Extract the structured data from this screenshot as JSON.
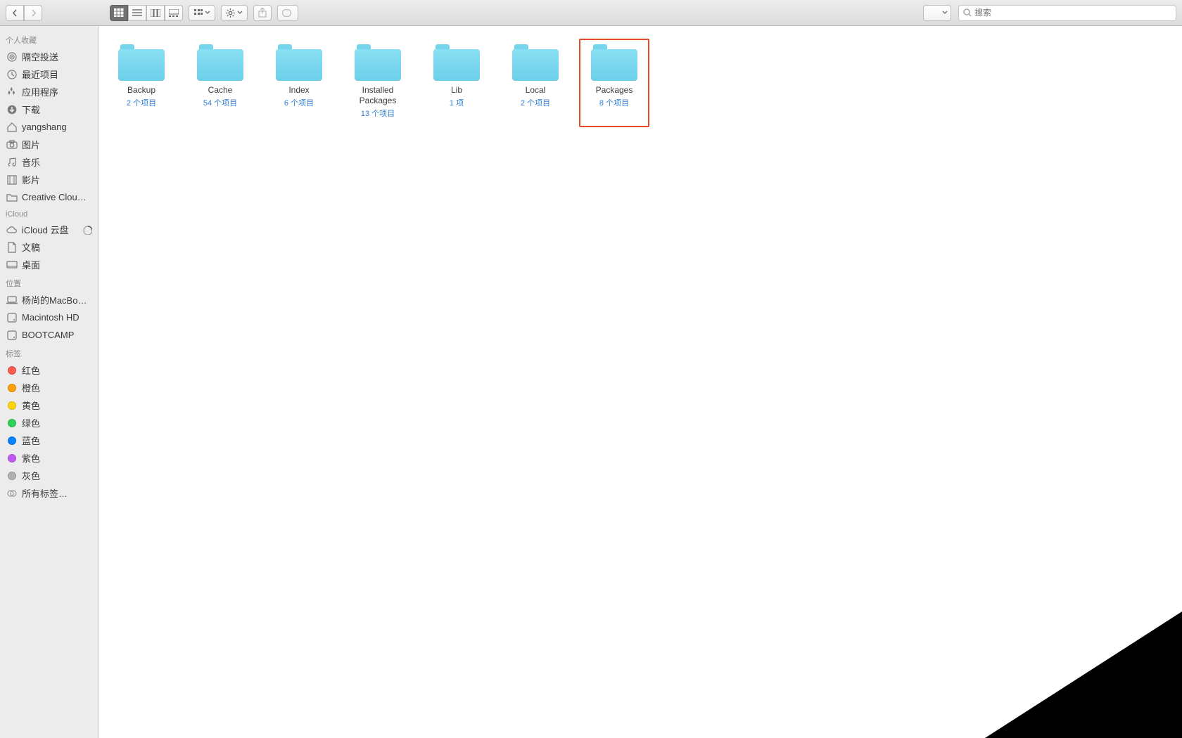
{
  "search": {
    "placeholder": "搜索"
  },
  "sidebar": {
    "sections": [
      {
        "title": "个人收藏",
        "items": [
          {
            "icon": "airdrop",
            "label": "隔空投送"
          },
          {
            "icon": "clock",
            "label": "最近项目"
          },
          {
            "icon": "apps",
            "label": "应用程序"
          },
          {
            "icon": "download",
            "label": "下载"
          },
          {
            "icon": "home",
            "label": "yangshang"
          },
          {
            "icon": "camera",
            "label": "图片"
          },
          {
            "icon": "music",
            "label": "音乐"
          },
          {
            "icon": "film",
            "label": "影片"
          },
          {
            "icon": "folder",
            "label": "Creative Clou…"
          }
        ]
      },
      {
        "title": "iCloud",
        "items": [
          {
            "icon": "cloud",
            "label": "iCloud 云盘",
            "trailing": "progress"
          },
          {
            "icon": "doc",
            "label": "文稿"
          },
          {
            "icon": "desktop",
            "label": "桌面"
          }
        ]
      },
      {
        "title": "位置",
        "items": [
          {
            "icon": "laptop",
            "label": "杨尚的MacBo…"
          },
          {
            "icon": "disk",
            "label": "Macintosh HD"
          },
          {
            "icon": "disk",
            "label": "BOOTCAMP"
          }
        ]
      },
      {
        "title": "标签",
        "items": [
          {
            "icon": "tag",
            "color": "#ff5b4f",
            "label": "红色"
          },
          {
            "icon": "tag",
            "color": "#ff9f0a",
            "label": "橙色"
          },
          {
            "icon": "tag",
            "color": "#ffd60a",
            "label": "黄色"
          },
          {
            "icon": "tag",
            "color": "#30d158",
            "label": "绿色"
          },
          {
            "icon": "tag",
            "color": "#0a84ff",
            "label": "蓝色"
          },
          {
            "icon": "tag",
            "color": "#bf5af2",
            "label": "紫色"
          },
          {
            "icon": "tag",
            "color": "#b0b0b0",
            "label": "灰色"
          },
          {
            "icon": "alltags",
            "label": "所有标签…"
          }
        ]
      }
    ]
  },
  "folders": [
    {
      "name": "Backup",
      "count": "2 个项目"
    },
    {
      "name": "Cache",
      "count": "54 个项目"
    },
    {
      "name": "Index",
      "count": "6 个项目"
    },
    {
      "name": "Installed Packages",
      "count": "13 个项目"
    },
    {
      "name": "Lib",
      "count": "1 项"
    },
    {
      "name": "Local",
      "count": "2 个项目"
    },
    {
      "name": "Packages",
      "count": "8 个项目",
      "highlight": true
    }
  ]
}
